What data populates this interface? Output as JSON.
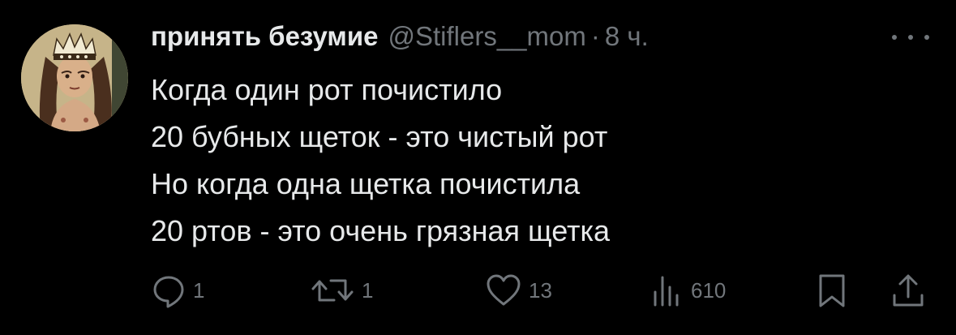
{
  "tweet": {
    "display_name": "принять безумие",
    "handle": "@Stiflers__mom",
    "separator": "·",
    "time": "8 ч.",
    "lines": [
      "Когда один рот почистило",
      "20 бубных щеток - это чистый рот",
      "Но когда одна щетка почистила",
      "20 ртов - это очень грязная щетка"
    ]
  },
  "actions": {
    "reply_icon": "reply-icon",
    "reply_count": "1",
    "retweet_icon": "retweet-icon",
    "retweet_count": "1",
    "like_icon": "heart-icon",
    "like_count": "13",
    "views_icon": "views-bar-chart-icon",
    "views_count": "610",
    "bookmark_icon": "bookmark-icon",
    "share_icon": "share-icon"
  },
  "colors": {
    "background": "#000000",
    "primary_text": "#e7e9ea",
    "secondary_text": "#71767b"
  }
}
